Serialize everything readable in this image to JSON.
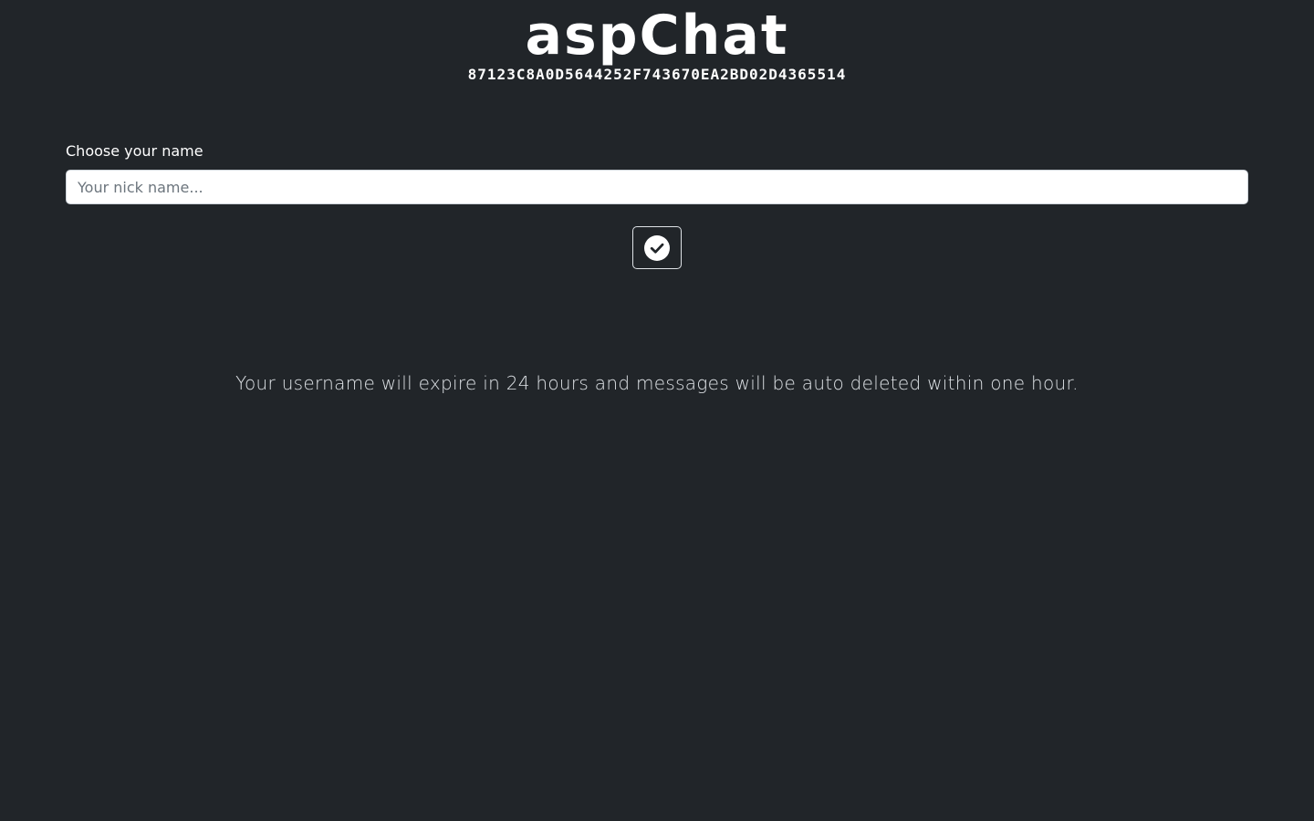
{
  "brand": {
    "title": "aspChat",
    "room_id": "87123C8A0D5644252F743670EA2BD02D4365514"
  },
  "form": {
    "label": "Choose your name",
    "nick_value": "",
    "nick_placeholder": "Your nick name...",
    "submit_icon": "check-circle-icon"
  },
  "notice": {
    "text": "Your username will expire in 24 hours and messages will be auto deleted within one hour."
  },
  "colors": {
    "background": "#212529",
    "text": "#ffffff",
    "muted_text": "#dee2e6",
    "input_background": "#ffffff",
    "placeholder": "#6c757d"
  }
}
